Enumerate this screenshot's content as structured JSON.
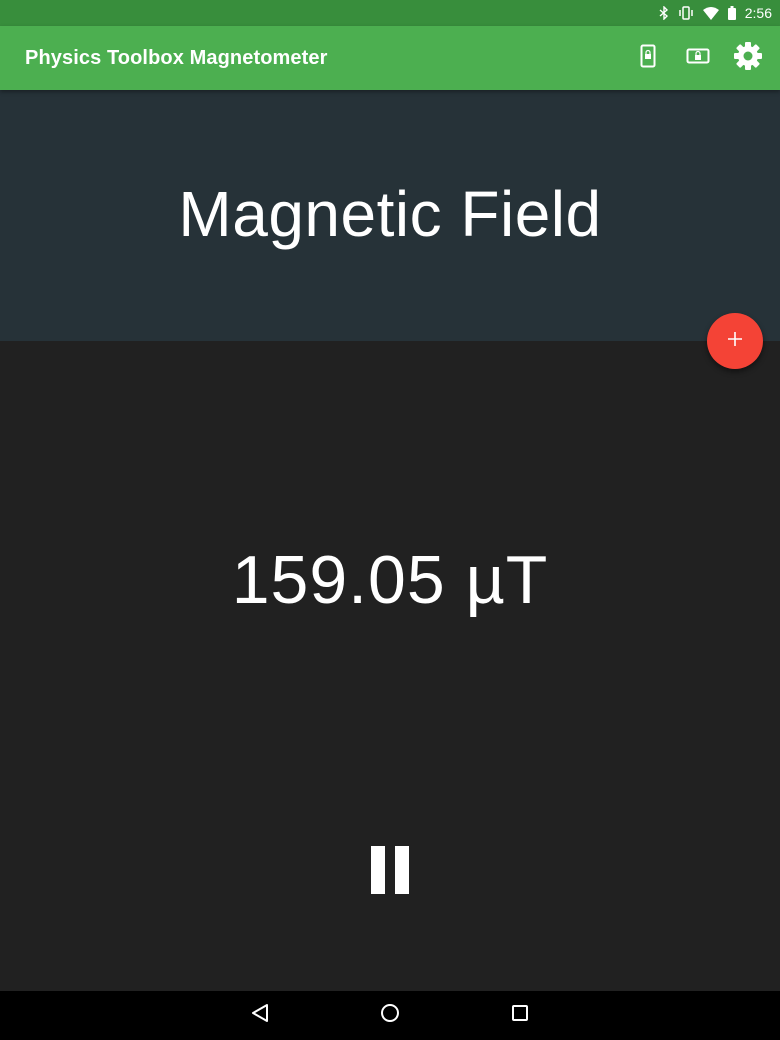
{
  "status_bar": {
    "time": "2:56",
    "icons": [
      "bluetooth-icon",
      "vibrate-icon",
      "wifi-icon",
      "battery-icon"
    ]
  },
  "app_bar": {
    "title": "Physics Toolbox Magnetometer",
    "actions": [
      "portrait-lock-icon",
      "landscape-lock-icon",
      "settings-gear-icon"
    ]
  },
  "header": {
    "title": "Magnetic Field"
  },
  "fab": {
    "icon": "plus-icon",
    "label": "+"
  },
  "reading": {
    "value": "159.05 µT"
  },
  "controls": {
    "pause_icon": "pause-icon"
  },
  "nav_bar": {
    "buttons": [
      "back-icon",
      "home-icon",
      "recents-icon"
    ]
  },
  "colors": {
    "status_bar": "#388e3c",
    "app_bar": "#4caf50",
    "header_bg": "#263238",
    "main_bg": "#212121",
    "fab": "#f44336",
    "nav_bar": "#000000"
  }
}
